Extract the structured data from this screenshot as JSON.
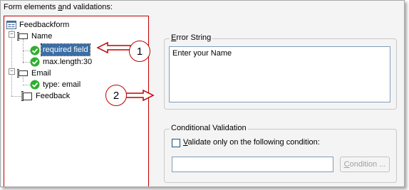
{
  "header": {
    "title_pre": "Form elements ",
    "title_accel": "a",
    "title_post": "nd validations:"
  },
  "tree": {
    "root": "Feedbackform",
    "name_node": "Name",
    "name_required": "required field",
    "name_maxlength": "max.length:30",
    "email_node": "Email",
    "email_type": "type: email",
    "feedback_node": "Feedback"
  },
  "error_group": {
    "legend_accel": "E",
    "legend_rest": "rror String",
    "value": "Enter your Name"
  },
  "conditional_group": {
    "legend": "Conditional Validation",
    "checkbox_accel": "V",
    "checkbox_rest": "alidate only on the following condition:",
    "checked": false,
    "condition_value": "",
    "button_accel": "C",
    "button_rest": "ondition ..."
  },
  "annotations": {
    "callout_1": "1",
    "callout_2": "2"
  },
  "colors": {
    "annotation_red": "#c00000",
    "check_green": "#2fae2f",
    "selection_blue": "#3a6ea5"
  }
}
